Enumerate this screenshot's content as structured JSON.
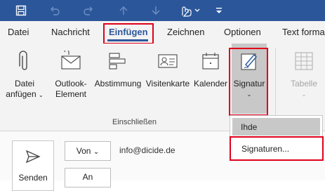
{
  "tabs": [
    "Datei",
    "Nachricht",
    "Einfügen",
    "Zeichnen",
    "Optionen",
    "Text forma"
  ],
  "ribbon": {
    "attach_line1": "Datei",
    "attach_line2": "anfügen",
    "outlook_line1": "Outlook-",
    "outlook_line2": "Element",
    "poll_label": "Abstimmung",
    "card_label": "Visitenkarte",
    "calendar_label": "Kalender",
    "signature_label": "Signatur",
    "table_label": "Tabelle",
    "group_label": "Einschließen"
  },
  "compose": {
    "send_label": "Senden",
    "from_label": "Von",
    "from_value": "info@dicide.de",
    "to_label": "An"
  },
  "dropdown": {
    "items": [
      "Ihde",
      "Signaturen..."
    ]
  },
  "colors": {
    "titlebar": "#2b579a",
    "highlight_box": "#e0001b",
    "active_tab_underline": "#2b579a"
  }
}
